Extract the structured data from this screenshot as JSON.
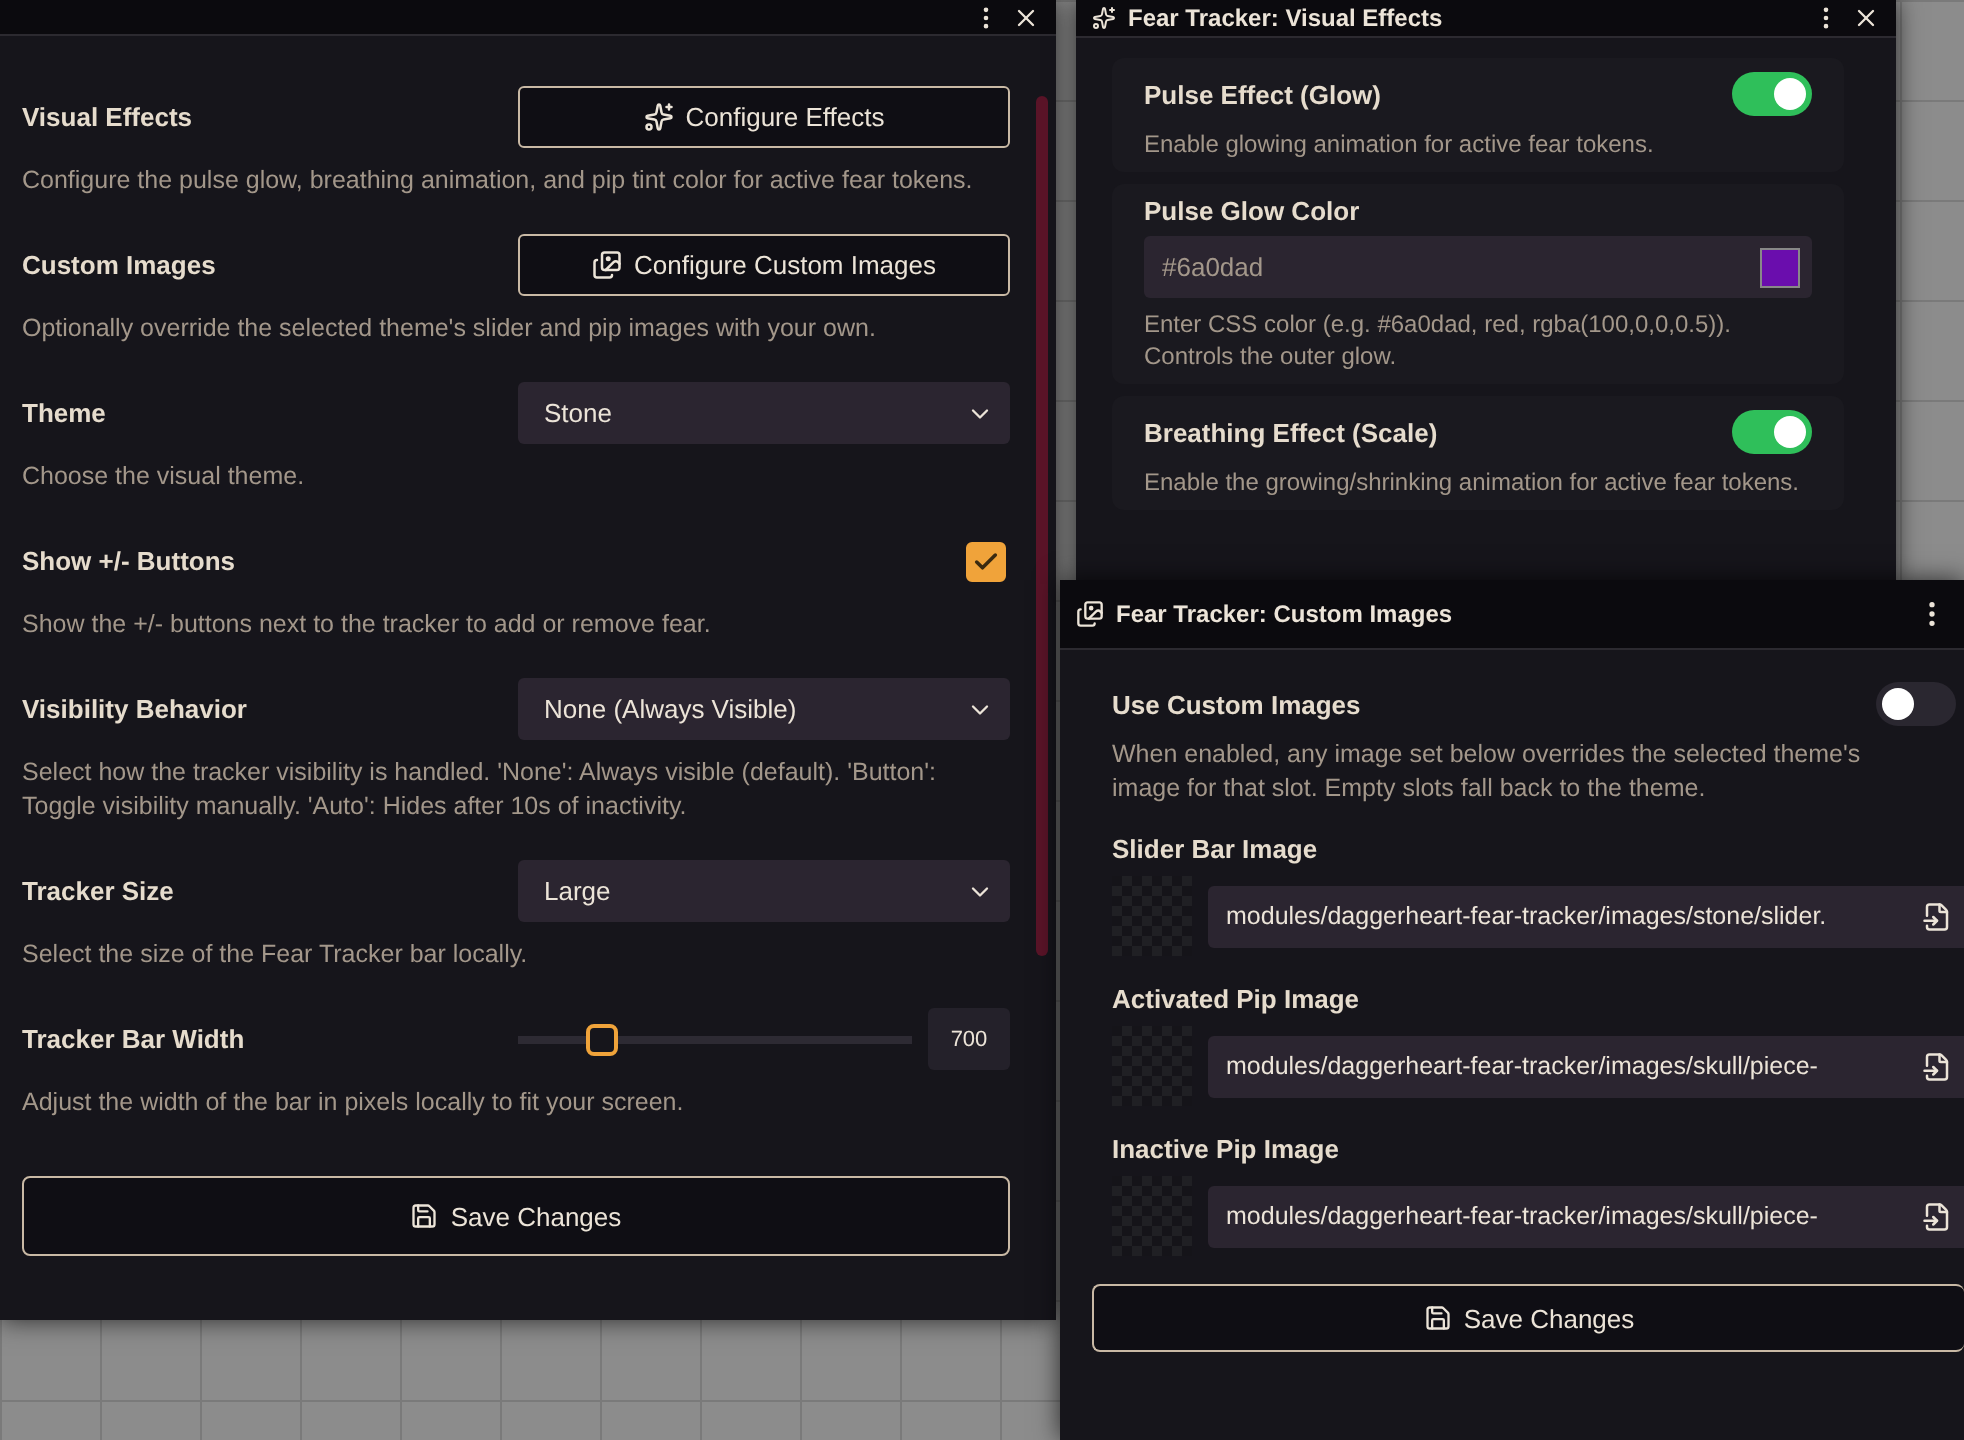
{
  "settings_window": {
    "rows": [
      {
        "kind": "button",
        "label": "Visual Effects",
        "button": "Configure Effects",
        "description": "Configure the pulse glow, breathing animation, and pip tint color for active fear tokens."
      },
      {
        "kind": "button",
        "label": "Custom Images",
        "button": "Configure Custom Images",
        "description": "Optionally override the selected theme's slider and pip images with your own."
      },
      {
        "kind": "select",
        "label": "Theme",
        "value": "Stone",
        "description": "Choose the visual theme."
      },
      {
        "kind": "checkbox",
        "label": "Show +/- Buttons",
        "checked": true,
        "description": "Show the +/- buttons next to the tracker to add or remove fear."
      },
      {
        "kind": "select",
        "label": "Visibility Behavior",
        "value": "None (Always Visible)",
        "description": "Select how the tracker visibility is handled. 'None': Always visible (default). 'Button': Toggle visibility manually. 'Auto': Hides after 10s of inactivity."
      },
      {
        "kind": "select",
        "label": "Tracker Size",
        "value": "Large",
        "description": "Select the size of the Fear Tracker bar locally."
      },
      {
        "kind": "slider",
        "label": "Tracker Bar Width",
        "level": 0.21,
        "reading": "700",
        "description": "Adjust the width of the bar in pixels locally to fit your screen."
      }
    ],
    "save_button": "Save Changes"
  },
  "visual_effects_window": {
    "title": "Fear Tracker: Visual Effects",
    "cards": [
      {
        "kind": "toggle",
        "label": "Pulse Effect (Glow)",
        "on": true,
        "description": "Enable glowing animation for active fear tokens."
      },
      {
        "kind": "color",
        "label": "Pulse Glow Color",
        "value": "#6a0dad",
        "color": "#6a0dad",
        "description": "Enter CSS color (e.g. #6a0dad, red, rgba(100,0,0,0.5)). Controls the outer glow."
      },
      {
        "kind": "toggle",
        "label": "Breathing Effect (Scale)",
        "on": true,
        "description": "Enable the growing/shrinking animation for active fear tokens."
      }
    ]
  },
  "custom_images_window": {
    "title": "Fear Tracker: Custom Images",
    "use_custom": {
      "label": "Use Custom Images",
      "on": false,
      "description": "When enabled, any image set below overrides the selected theme's image for that slot. Empty slots fall back to the theme."
    },
    "images": [
      {
        "label": "Slider Bar Image",
        "path": "modules/daggerheart-fear-tracker/images/stone/slider."
      },
      {
        "label": "Activated Pip Image",
        "path": "modules/daggerheart-fear-tracker/images/skull/piece-"
      },
      {
        "label": "Inactive Pip Image",
        "path": "modules/daggerheart-fear-tracker/images/skull/piece-"
      }
    ],
    "save_button": "Save Changes"
  }
}
